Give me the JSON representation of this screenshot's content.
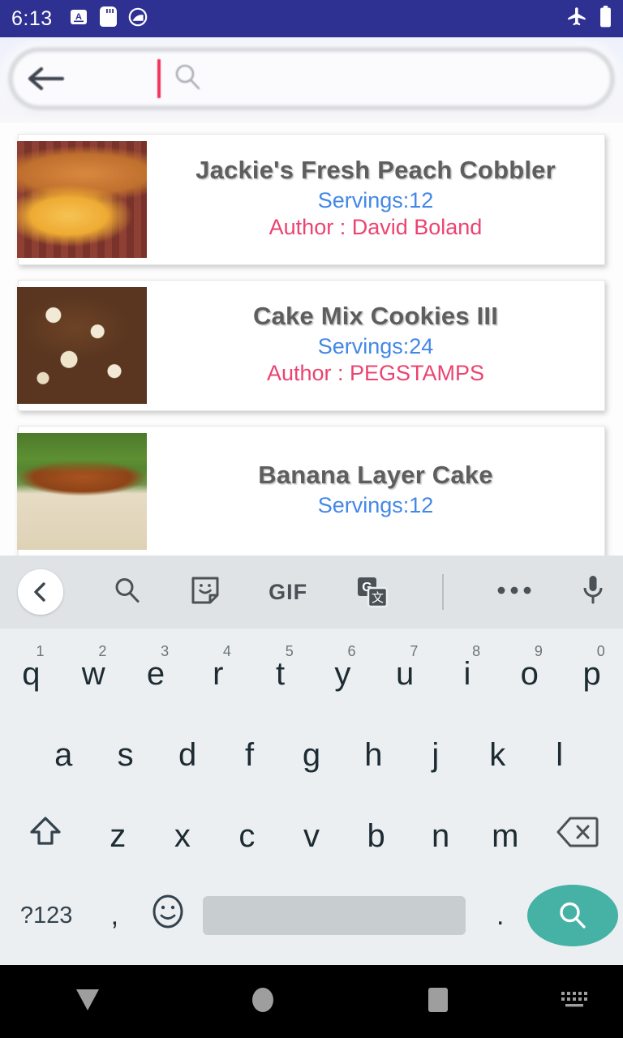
{
  "status_bar": {
    "time": "6:13",
    "left_icons": [
      "subtitle-a-icon",
      "sd-card-icon",
      "do-not-disturb-icon"
    ],
    "right_icons": [
      "airplane-mode-icon",
      "battery-full-icon"
    ],
    "background_color": "#2e3192"
  },
  "search": {
    "value": "",
    "placeholder": "",
    "back_icon": "back-arrow-icon",
    "search_icon": "search-icon",
    "cursor_color": "#f0325b"
  },
  "results": [
    {
      "title": "Jackie's Fresh Peach Cobbler",
      "servings": "Servings:12",
      "author": "Author : David Boland",
      "image": "peach-cobbler-photo"
    },
    {
      "title": "Cake Mix Cookies III",
      "servings": "Servings:24",
      "author": "Author : PEGSTAMPS",
      "image": "cake-mix-cookies-photo"
    },
    {
      "title": "Banana Layer Cake",
      "servings": "Servings:12",
      "author": "",
      "image": "banana-layer-cake-photo"
    }
  ],
  "colors": {
    "servings": "#4387e8",
    "author": "#ec4370",
    "title": "#5e5e5e",
    "accent_fab": "#45b2a5"
  },
  "keyboard": {
    "toolbar": [
      {
        "name": "expand-toolbar-button",
        "icon": "chevron-left-icon"
      },
      {
        "name": "search-button",
        "icon": "search-icon"
      },
      {
        "name": "sticker-button",
        "icon": "sticker-icon"
      },
      {
        "name": "gif-button",
        "icon": "gif-icon",
        "label": "GIF"
      },
      {
        "name": "translate-button",
        "icon": "google-translate-icon"
      },
      {
        "name": "more-options-button",
        "icon": "overflow-dots-icon"
      },
      {
        "name": "voice-input-button",
        "icon": "microphone-icon"
      }
    ],
    "row1": [
      {
        "key": "q",
        "num": "1"
      },
      {
        "key": "w",
        "num": "2"
      },
      {
        "key": "e",
        "num": "3"
      },
      {
        "key": "r",
        "num": "4"
      },
      {
        "key": "t",
        "num": "5"
      },
      {
        "key": "y",
        "num": "6"
      },
      {
        "key": "u",
        "num": "7"
      },
      {
        "key": "i",
        "num": "8"
      },
      {
        "key": "o",
        "num": "9"
      },
      {
        "key": "p",
        "num": "0"
      }
    ],
    "row2": [
      "a",
      "s",
      "d",
      "f",
      "g",
      "h",
      "j",
      "k",
      "l"
    ],
    "row3": [
      "z",
      "x",
      "c",
      "v",
      "b",
      "n",
      "m"
    ],
    "shift_icon": "shift-icon",
    "backspace_icon": "backspace-icon",
    "row4": {
      "symbols_label": "?123",
      "comma_label": ",",
      "emoji_icon": "emoji-icon",
      "space_label": "",
      "period_label": ".",
      "action_icon": "search-icon"
    }
  },
  "nav_bar": {
    "items": [
      {
        "name": "back-button",
        "icon": "down-triangle-icon"
      },
      {
        "name": "home-button",
        "icon": "circle-icon"
      },
      {
        "name": "recents-button",
        "icon": "square-icon"
      },
      {
        "name": "keyboard-switcher-button",
        "icon": "keyboard-icon"
      }
    ]
  }
}
